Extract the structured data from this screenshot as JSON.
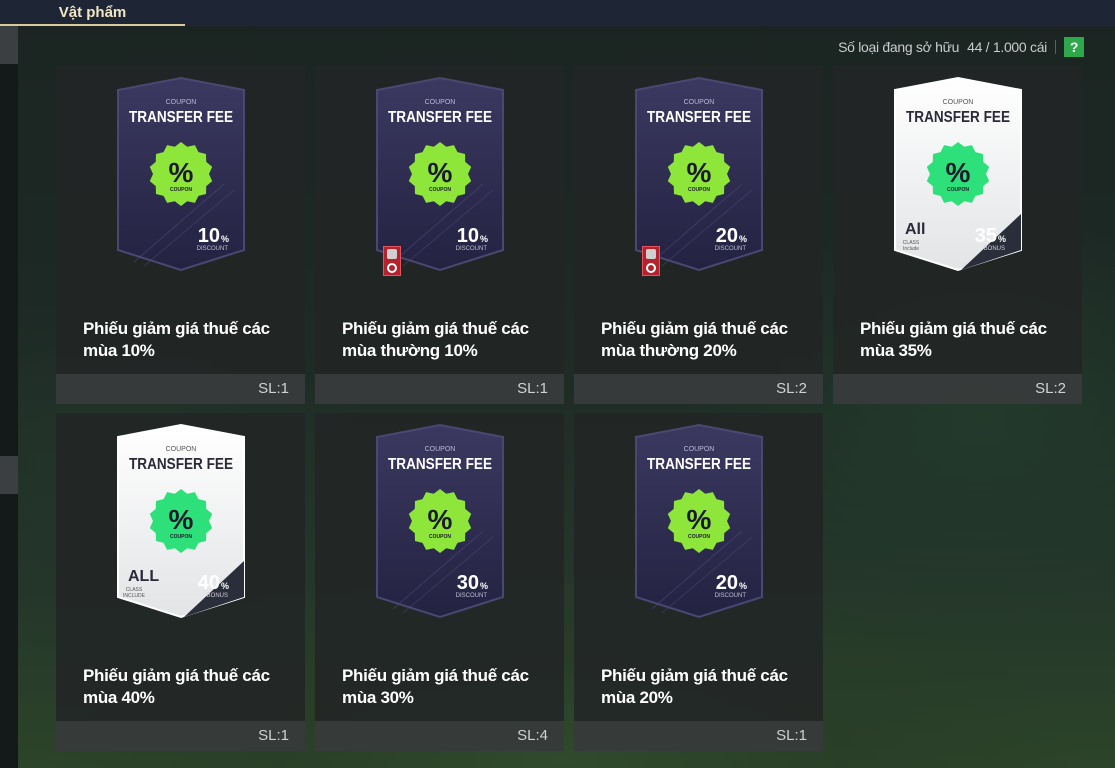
{
  "tabs": {
    "active_label": "Vật phẩm"
  },
  "inventory": {
    "count_label": "Số loại đang sở hữu",
    "count_value": "44 / 1.000 cái",
    "help_label": "?"
  },
  "coupon_text": {
    "coupon": "COUPON",
    "transfer_fee": "TRANSFER FEE",
    "percent": "%"
  },
  "items": [
    {
      "name": "Phiếu giảm giá thuế các mùa 10%",
      "qty": "SL:1",
      "amount": "10",
      "kind": "DISCOUNT",
      "style": "dark",
      "locked": false
    },
    {
      "name": "Phiếu giảm giá thuế các mùa thường 10%",
      "qty": "SL:1",
      "amount": "10",
      "kind": "DISCOUNT",
      "style": "dark",
      "locked": true
    },
    {
      "name": "Phiếu giảm giá thuế các mùa thường 20%",
      "qty": "SL:2",
      "amount": "20",
      "kind": "DISCOUNT",
      "style": "dark",
      "locked": true
    },
    {
      "name": "Phiếu giảm giá thuế các mùa 35%",
      "qty": "SL:2",
      "amount": "35",
      "kind": "BONUS",
      "style": "light",
      "locked": false,
      "class_top": "All",
      "class_sub": "CLASS",
      "class_sub2": "Include"
    },
    {
      "name": "Phiếu giảm giá thuế các mùa 40%",
      "qty": "SL:1",
      "amount": "40",
      "kind": "BONUS",
      "style": "light",
      "locked": false,
      "class_top": "ALL",
      "class_sub": "CLASS",
      "class_sub2": "INCLUDE"
    },
    {
      "name": "Phiếu giảm giá thuế các mùa 30%",
      "qty": "SL:4",
      "amount": "30",
      "kind": "DISCOUNT",
      "style": "dark",
      "locked": false
    },
    {
      "name": "Phiếu giảm giá thuế các mùa 20%",
      "qty": "SL:1",
      "amount": "20",
      "kind": "DISCOUNT",
      "style": "dark",
      "locked": false
    }
  ],
  "colors": {
    "badge_green": "#8ee63b",
    "badge_green_light": "#2de07a",
    "card_dark": "#2c2a4a",
    "accent": "#d9c99b"
  }
}
